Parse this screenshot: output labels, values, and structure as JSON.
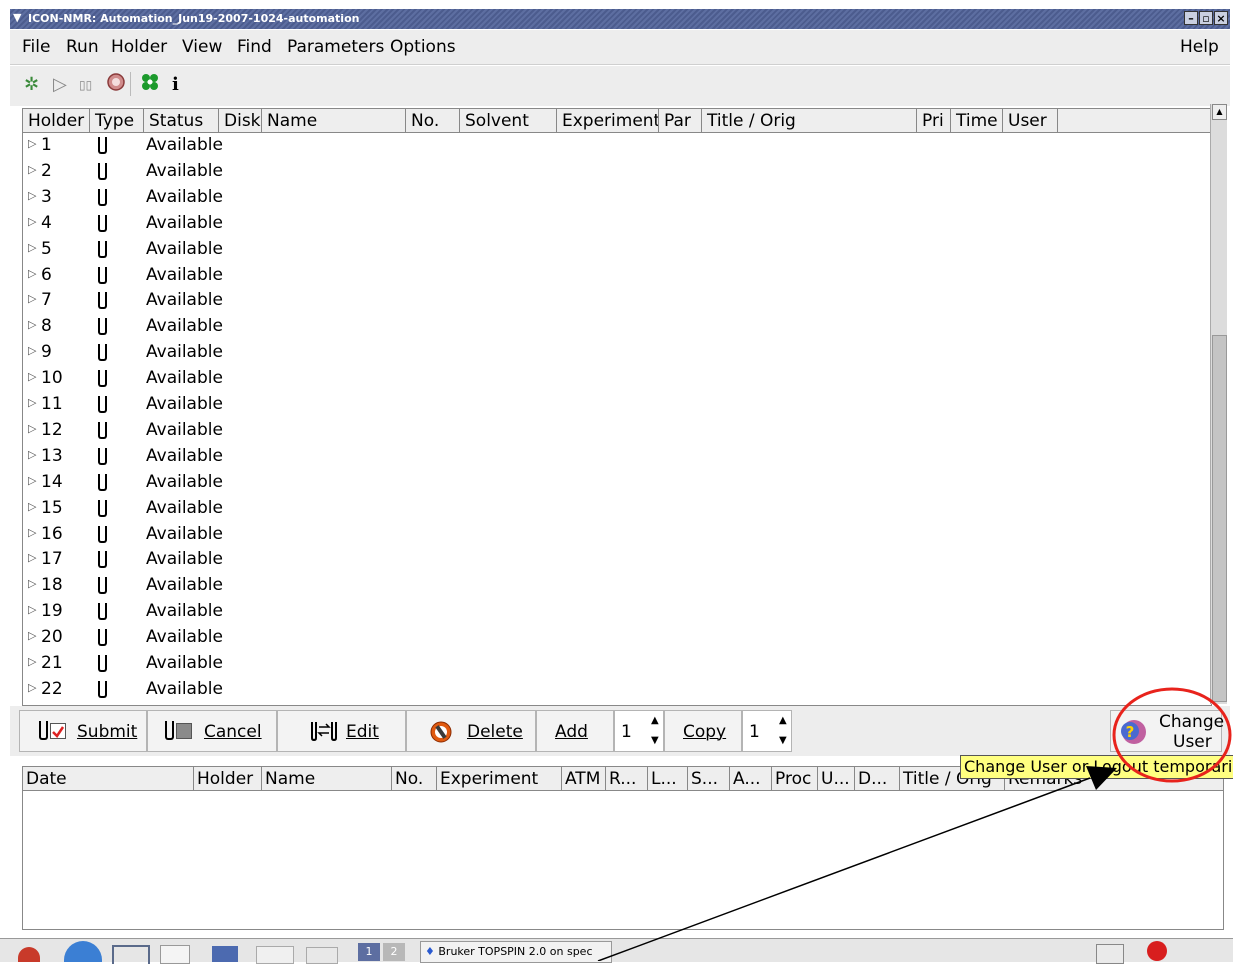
{
  "window": {
    "title": "ICON-NMR: Automation_Jun19-2007-1024-automation",
    "minimize": "–",
    "maximize": "▫",
    "close": "×"
  },
  "menubar": {
    "items": [
      "File",
      "Run",
      "Holder",
      "View",
      "Find",
      "Parameters",
      "Options"
    ],
    "help": "Help"
  },
  "toolbar": {
    "icons": [
      "settings-gear-icon",
      "play-icon",
      "pause-icon",
      "stop-icon",
      "clover-icon",
      "info-icon"
    ],
    "info_glyph": "i"
  },
  "holder_table": {
    "columns": [
      "Holder",
      "Type",
      "Status",
      "Disk",
      "Name",
      "No.",
      "Solvent",
      "Experiment",
      "Par",
      "Title / Orig",
      "Pri",
      "Time",
      "User"
    ],
    "rows": [
      {
        "holder": "1",
        "status": "Available"
      },
      {
        "holder": "2",
        "status": "Available"
      },
      {
        "holder": "3",
        "status": "Available"
      },
      {
        "holder": "4",
        "status": "Available"
      },
      {
        "holder": "5",
        "status": "Available"
      },
      {
        "holder": "6",
        "status": "Available"
      },
      {
        "holder": "7",
        "status": "Available"
      },
      {
        "holder": "8",
        "status": "Available"
      },
      {
        "holder": "9",
        "status": "Available"
      },
      {
        "holder": "10",
        "status": "Available"
      },
      {
        "holder": "11",
        "status": "Available"
      },
      {
        "holder": "12",
        "status": "Available"
      },
      {
        "holder": "13",
        "status": "Available"
      },
      {
        "holder": "14",
        "status": "Available"
      },
      {
        "holder": "15",
        "status": "Available"
      },
      {
        "holder": "16",
        "status": "Available"
      },
      {
        "holder": "17",
        "status": "Available"
      },
      {
        "holder": "18",
        "status": "Available"
      },
      {
        "holder": "19",
        "status": "Available"
      },
      {
        "holder": "20",
        "status": "Available"
      },
      {
        "holder": "21",
        "status": "Available"
      },
      {
        "holder": "22",
        "status": "Available"
      }
    ]
  },
  "actions": {
    "submit": "Submit",
    "cancel": "Cancel",
    "edit": "Edit",
    "delete": "Delete",
    "add": "Add",
    "add_count": "1",
    "copy": "Copy",
    "copy_count": "1",
    "change_user_line1": "Change",
    "change_user_line2": "User"
  },
  "tooltip": "Change User or Logout temporarily",
  "log_table": {
    "columns": [
      "Date",
      "Holder",
      "Name",
      "No.",
      "Experiment",
      "ATM",
      "R...",
      "L...",
      "S...",
      "A...",
      "Proc",
      "U...",
      "D...",
      "Title / Orig",
      "Remarks"
    ]
  },
  "taskbar": {
    "workspace_1": "1",
    "workspace_2": "2",
    "task_label": "Bruker TOPSPIN 2.0 on spec"
  },
  "colors": {
    "titlebar": "#4c5c8e",
    "tooltip": "#ffff80",
    "annotation_circle": "#e8231c",
    "delete_icon": "#e05a10"
  }
}
